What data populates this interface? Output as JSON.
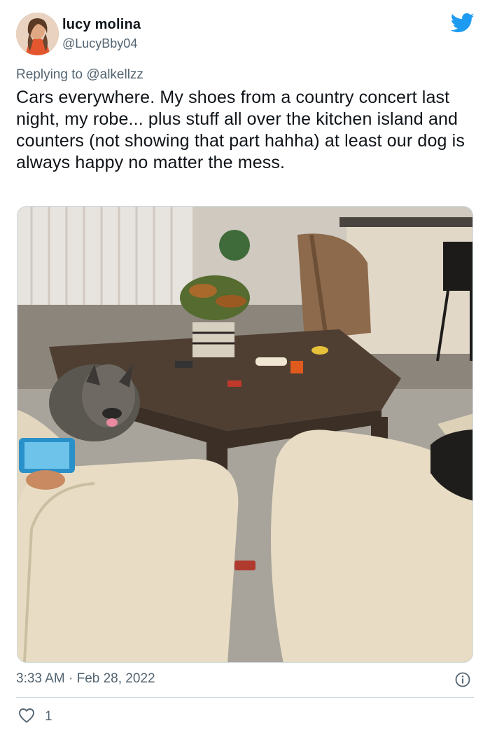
{
  "author": {
    "name": "lucy molina",
    "handle": "@LucyBby04",
    "avatar_icon": "profile-photo"
  },
  "reply": {
    "prefix": "Replying to",
    "mention": "@alkellzz"
  },
  "tweet_text": "Cars everywhere. My shoes from a country concert last night, my robe... plus stuff all over the kitchen island and counters (not showing that part hahha) at least our dog is always happy no matter the mess.",
  "media": {
    "icon": "photo-living-room-with-dog"
  },
  "meta": {
    "timestamp": "3:33 AM · Feb 28, 2022"
  },
  "engagement": {
    "likes": "1"
  },
  "colors": {
    "twitter_blue": "#1d9bf0",
    "secondary_text": "#536471"
  }
}
